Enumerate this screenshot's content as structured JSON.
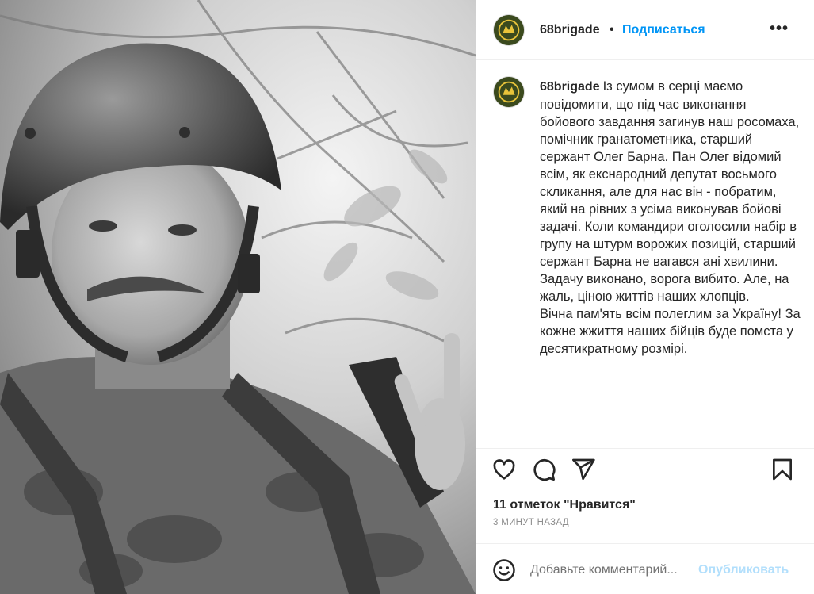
{
  "post": {
    "username": "68brigade",
    "separator": "•",
    "follow_label": "Подписаться",
    "more_label": "•••",
    "caption": "Із сумом в серці маємо повідомити, що під час виконання бойового завдання загинув наш росомаха, помічник гранатометника, старший сержант Олег Барна. Пан Олег відомий всім, як екснародний депутат восьмого скликання, але для нас він - побратим, який на рівних з усіма виконував бойові задачі. Коли командири оголосили набір в групу на штурм ворожих позицій, старший сержант Барна не вагався ані хвилини. Задачу виконано, ворога вибито. Але, на жаль, ціною життів наших хлопців.\nВічна пам'ять всім полеглим за Україну! За кожне жжиття наших бійців буде помста у десятикратному розмірі.",
    "likes": "11 отметок \"Нравится\"",
    "time": "3 МИНУТ НАЗАД"
  },
  "comment": {
    "placeholder": "Добавьте комментарий...",
    "publish_label": "Опубликовать"
  },
  "icons": {
    "like": "heart-icon",
    "comment": "comment-icon",
    "share": "share-icon",
    "save": "bookmark-icon",
    "emoji": "emoji-icon",
    "avatar": "brigade-emblem"
  },
  "colors": {
    "accent": "#0095f6",
    "publish_disabled": "#b2dffc",
    "meta": "#8e8e8e",
    "avatar_bg": "#3b4a1e",
    "avatar_emblem": "#e8c33a"
  }
}
